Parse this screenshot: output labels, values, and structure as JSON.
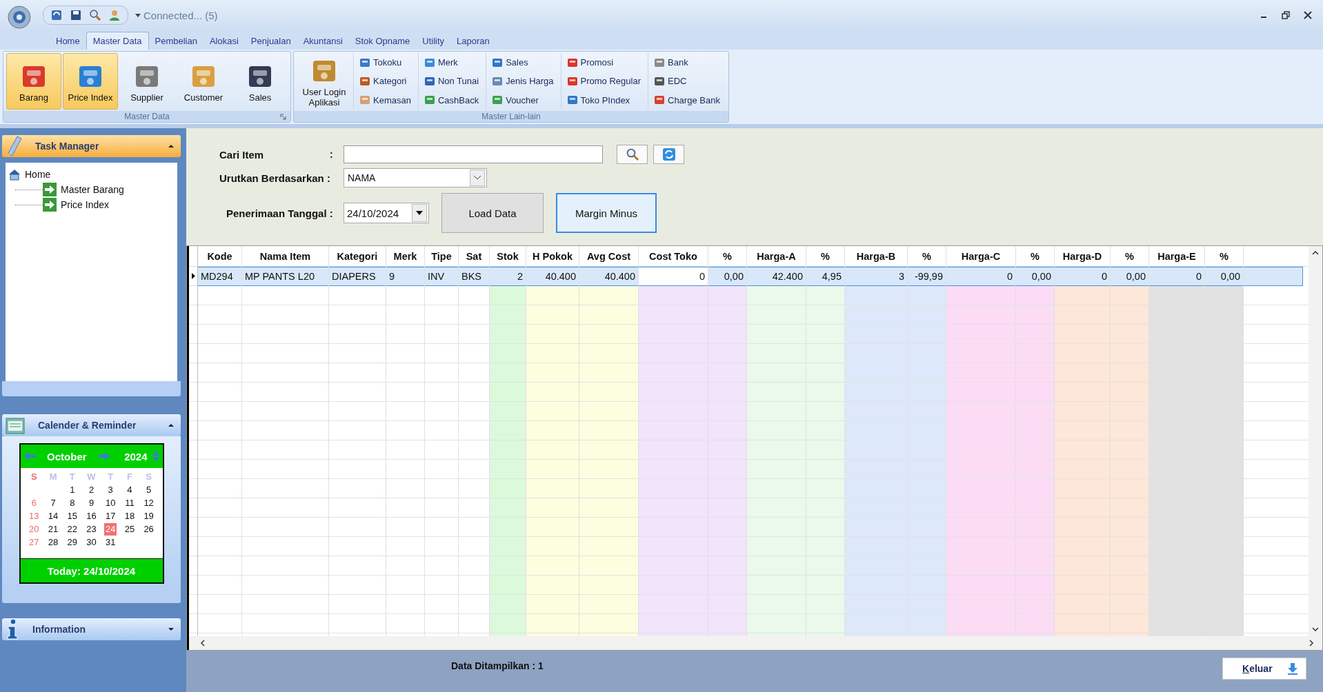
{
  "window": {
    "connection_status": "Connected... (5)"
  },
  "ribbon": {
    "tabs": [
      {
        "label": "Home",
        "selected": false
      },
      {
        "label": "Master Data",
        "selected": true
      },
      {
        "label": "Pembelian",
        "selected": false
      },
      {
        "label": "Alokasi",
        "selected": false
      },
      {
        "label": "Penjualan",
        "selected": false
      },
      {
        "label": "Akuntansi",
        "selected": false
      },
      {
        "label": "Stok Opname",
        "selected": false
      },
      {
        "label": "Utility",
        "selected": false
      },
      {
        "label": "Laporan",
        "selected": false
      }
    ],
    "groups": [
      {
        "title": "Master Data",
        "launcher": true,
        "large_buttons": [
          {
            "label": "Barang",
            "highlighted": true
          },
          {
            "label": "Price Index",
            "highlighted": true
          },
          {
            "label": "Supplier",
            "highlighted": false
          },
          {
            "label": "Customer",
            "highlighted": false
          },
          {
            "label": "Sales",
            "highlighted": false
          }
        ]
      },
      {
        "title": "Master Lain-lain",
        "launcher": false,
        "large_buttons": [
          {
            "label": "User Login Aplikasi",
            "highlighted": false
          }
        ],
        "small_columns": [
          [
            "Tokoku",
            "Kategori",
            "Kemasan"
          ],
          [
            "Merk",
            "Non Tunai",
            "CashBack"
          ],
          [
            "Sales",
            "Jenis Harga",
            "Voucher"
          ],
          [
            "Promosi",
            "Promo Regular",
            "Toko PIndex"
          ],
          [
            "Bank",
            "EDC",
            "Charge Bank"
          ]
        ]
      }
    ]
  },
  "sidebar": {
    "task_manager": {
      "title": "Task Manager",
      "expanded": true,
      "tree": [
        {
          "label": "Home",
          "children": [
            {
              "label": "Master Barang"
            },
            {
              "label": "Price Index"
            }
          ]
        }
      ]
    },
    "calendar_panel": {
      "title": "Calender & Reminder",
      "expanded": true,
      "calendar": {
        "month": "October",
        "year": "2024",
        "weekdays": [
          "S",
          "M",
          "T",
          "W",
          "T",
          "F",
          "S"
        ],
        "weeks": [
          [
            {
              "day": "1",
              "selected": false
            },
            {
              "day": "2",
              "selected": false
            },
            {
              "day": "3",
              "selected": false
            },
            {
              "day": "4",
              "selected": false
            },
            {
              "day": "5",
              "selected": false
            }
          ],
          [
            {
              "day": "6",
              "selected": false
            },
            {
              "day": "7",
              "selected": false
            },
            {
              "day": "8",
              "selected": false
            },
            {
              "day": "9",
              "selected": false
            },
            {
              "day": "10",
              "selected": false
            },
            {
              "day": "11",
              "selected": false
            },
            {
              "day": "12",
              "selected": false
            }
          ],
          [
            {
              "day": "13",
              "selected": false
            },
            {
              "day": "14",
              "selected": false
            },
            {
              "day": "15",
              "selected": false
            },
            {
              "day": "16",
              "selected": false
            },
            {
              "day": "17",
              "selected": false
            },
            {
              "day": "18",
              "selected": false
            },
            {
              "day": "19",
              "selected": false
            }
          ],
          [
            {
              "day": "20",
              "selected": false
            },
            {
              "day": "21",
              "selected": false
            },
            {
              "day": "22",
              "selected": false
            },
            {
              "day": "23",
              "selected": false
            },
            {
              "day": "24",
              "selected": true
            },
            {
              "day": "25",
              "selected": false
            },
            {
              "day": "26",
              "selected": false
            }
          ],
          [
            {
              "day": "27",
              "selected": false
            },
            {
              "day": "28",
              "selected": false
            },
            {
              "day": "29",
              "selected": false
            },
            {
              "day": "30",
              "selected": false
            },
            {
              "day": "31",
              "selected": false
            }
          ]
        ],
        "today": "Today: 24/10/2024"
      }
    },
    "information": {
      "title": "Information",
      "expanded": false
    }
  },
  "form": {
    "search": {
      "label": "Cari Item",
      "separator": ":"
    },
    "sort": {
      "label": "Urutkan Berdasarkan :",
      "value": "NAMA"
    },
    "date": {
      "label": "Penerimaan Tanggal :",
      "value": "24/10/2024"
    },
    "buttons": [
      {
        "label": "Load Data",
        "kind": "plain"
      },
      {
        "label": "Margin Minus",
        "kind": "focused"
      }
    ]
  },
  "table": {
    "columns": [
      {
        "label": "Kode",
        "kind": "text"
      },
      {
        "label": "Nama Item",
        "kind": "text"
      },
      {
        "label": "Kategori",
        "kind": "text"
      },
      {
        "label": "Merk",
        "kind": "text"
      },
      {
        "label": "Tipe",
        "kind": "text"
      },
      {
        "label": "Sat",
        "kind": "text"
      },
      {
        "label": "Stok",
        "kind": "number",
        "color": "#dcf9dc"
      },
      {
        "label": "H Pokok",
        "kind": "number",
        "color": "#fdfde0"
      },
      {
        "label": "Avg Cost",
        "kind": "number",
        "color": "#fdfde0"
      },
      {
        "label": "Cost Toko",
        "kind": "number",
        "color": "#f1e4fb"
      },
      {
        "label": "%",
        "kind": "number",
        "color": "#f1e4fb"
      },
      {
        "label": "Harga-A",
        "kind": "number",
        "color": "#eaf9ea"
      },
      {
        "label": "%",
        "kind": "number",
        "color": "#eaf9ea"
      },
      {
        "label": "Harga-B",
        "kind": "number",
        "color": "#dde9fa"
      },
      {
        "label": "%",
        "kind": "number",
        "color": "#dde9fa"
      },
      {
        "label": "Harga-C",
        "kind": "number",
        "color": "#fcdcf5"
      },
      {
        "label": "%",
        "kind": "number",
        "color": "#fcdcf5"
      },
      {
        "label": "Harga-D",
        "kind": "number",
        "color": "#fde7d8"
      },
      {
        "label": "%",
        "kind": "number",
        "color": "#fde7d8"
      },
      {
        "label": "Harga-E",
        "kind": "number",
        "color": "#e2e2e2"
      },
      {
        "label": "%",
        "kind": "number",
        "color": "#e2e2e2"
      }
    ],
    "rows": [
      {
        "selected": true,
        "cells": [
          "MD294",
          "MP PANTS L20",
          "DIAPERS",
          "9",
          "INV",
          "BKS",
          "2",
          "40.400",
          "40.400",
          "0",
          "0,00",
          "42.400",
          "4,95",
          "3",
          "-99,99",
          "0",
          "0,00",
          "0",
          "0,00",
          "0",
          "0,00"
        ]
      }
    ]
  },
  "status_bar": {
    "text": "Data Ditampilkan : 1",
    "exit_button": {
      "label": "Keluar",
      "accelerator": true
    }
  }
}
